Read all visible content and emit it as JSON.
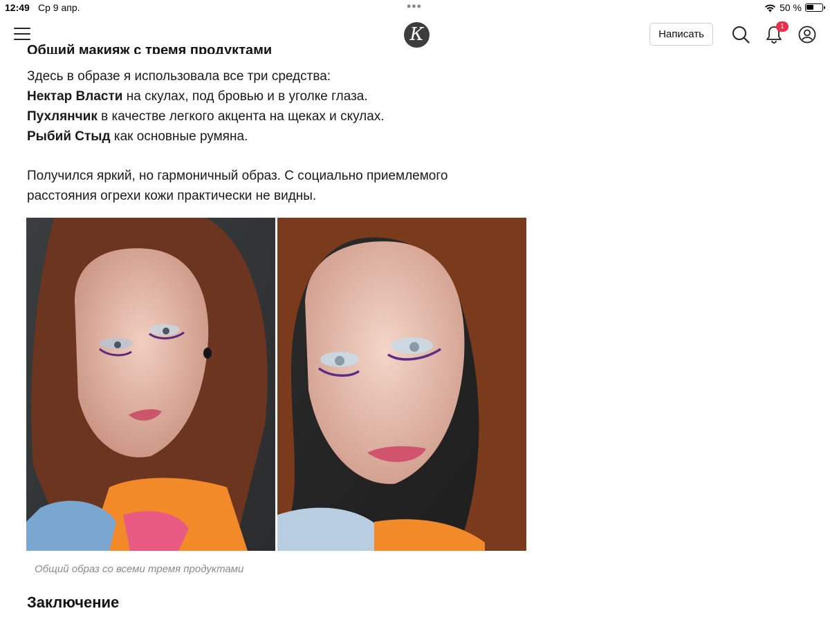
{
  "status_bar": {
    "time": "12:49",
    "date": "Ср 9 апр.",
    "battery_text": "50 %",
    "battery_level": 0.5
  },
  "nav": {
    "logo_letter": "К",
    "write_button": "Написать",
    "notification_count": "1"
  },
  "article": {
    "cut_heading": "Общий макияж с тремя продуктами",
    "paragraph1": {
      "intro": "Здесь в образе я использовала все три средства:",
      "lines": [
        {
          "bold": "Нектар Власти",
          "text": " на скулах, под бровью и в уголке глаза."
        },
        {
          "bold": "Пухлянчик",
          "text": " в качестве легкого акцента на щеках и скулах."
        },
        {
          "bold": "Рыбий Стыд",
          "text": " как основные румяна."
        }
      ]
    },
    "paragraph2": {
      "line1": "Получился яркий, но гармоничный образ. С социально приемлемого",
      "line2": "расстояния огрехи кожи практически не видны."
    },
    "photo_caption": "Общий образ со всеми тремя продуктами",
    "section_title": "Заключение"
  },
  "colors": {
    "badge": "#e8304a",
    "logo_bg": "#3d3d3d",
    "caption": "#8a8a8a"
  },
  "icons": [
    "menu-icon",
    "search-icon",
    "bell-icon",
    "user-icon",
    "wifi-icon",
    "battery-icon"
  ]
}
